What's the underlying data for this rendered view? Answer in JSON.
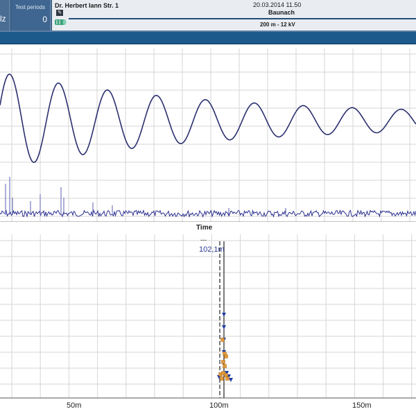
{
  "header": {
    "unit_fragment": "lz",
    "test_periods_label": "Test periods",
    "test_periods_value": "0",
    "address": "Dr. Herbert Iann Str. 1",
    "datetime": "20.03.2014 11.50",
    "location": "Baunach",
    "cable_info": "200 m - 12 kV"
  },
  "chart_data": [
    {
      "type": "line",
      "title": "",
      "xlabel": "Time",
      "ylabel": "",
      "grid": true,
      "series": [
        {
          "kind": "damped-oscillation",
          "color": "#2a2f6e",
          "periods_visible": 8.5,
          "decay": "exponential"
        },
        {
          "kind": "noise-baseline",
          "color": "#2a2f8e"
        }
      ]
    },
    {
      "type": "scatter",
      "title": "",
      "xlabel": "",
      "ylabel": "",
      "grid": true,
      "x_ticks": [
        "50m",
        "100m",
        "150m"
      ],
      "cursor_label": "---",
      "cursor_value": "102,1m",
      "marker_colors": {
        "triangle": "#1f3fa8",
        "square": "#e39a3a"
      }
    }
  ]
}
